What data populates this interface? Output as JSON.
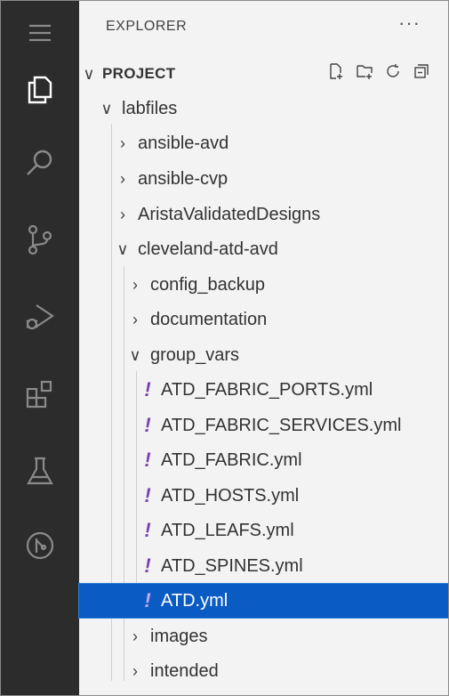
{
  "explorer": {
    "title": "EXPLORER",
    "more": "···"
  },
  "section": {
    "title": "PROJECT"
  },
  "tree": [
    {
      "label": "labfiles",
      "type": "folder",
      "expanded": true
    },
    {
      "label": "ansible-avd",
      "type": "folder",
      "expanded": false
    },
    {
      "label": "ansible-cvp",
      "type": "folder",
      "expanded": false
    },
    {
      "label": "AristaValidatedDesigns",
      "type": "folder",
      "expanded": false
    },
    {
      "label": "cleveland-atd-avd",
      "type": "folder",
      "expanded": true
    },
    {
      "label": "config_backup",
      "type": "folder",
      "expanded": false
    },
    {
      "label": "documentation",
      "type": "folder",
      "expanded": false
    },
    {
      "label": "group_vars",
      "type": "folder",
      "expanded": true
    },
    {
      "label": "ATD_FABRIC_PORTS.yml",
      "type": "yaml"
    },
    {
      "label": "ATD_FABRIC_SERVICES.yml",
      "type": "yaml"
    },
    {
      "label": "ATD_FABRIC.yml",
      "type": "yaml"
    },
    {
      "label": "ATD_HOSTS.yml",
      "type": "yaml"
    },
    {
      "label": "ATD_LEAFS.yml",
      "type": "yaml"
    },
    {
      "label": "ATD_SPINES.yml",
      "type": "yaml"
    },
    {
      "label": "ATD.yml",
      "type": "yaml",
      "selected": true
    },
    {
      "label": "images",
      "type": "folder",
      "expanded": false
    },
    {
      "label": "intended",
      "type": "folder",
      "expanded": false
    }
  ],
  "glyphs": {
    "expanded": "∨",
    "collapsed": "›",
    "yaml": "!"
  },
  "colors": {
    "activity_bar": "#2c2c2c",
    "selection": "#0a5bc4",
    "yaml_icon": "#7b3fb3"
  },
  "activity_icons": [
    "menu-icon",
    "files-icon",
    "search-icon",
    "source-control-icon",
    "run-debug-icon",
    "extensions-icon",
    "testing-icon",
    "remote-explorer-icon"
  ]
}
